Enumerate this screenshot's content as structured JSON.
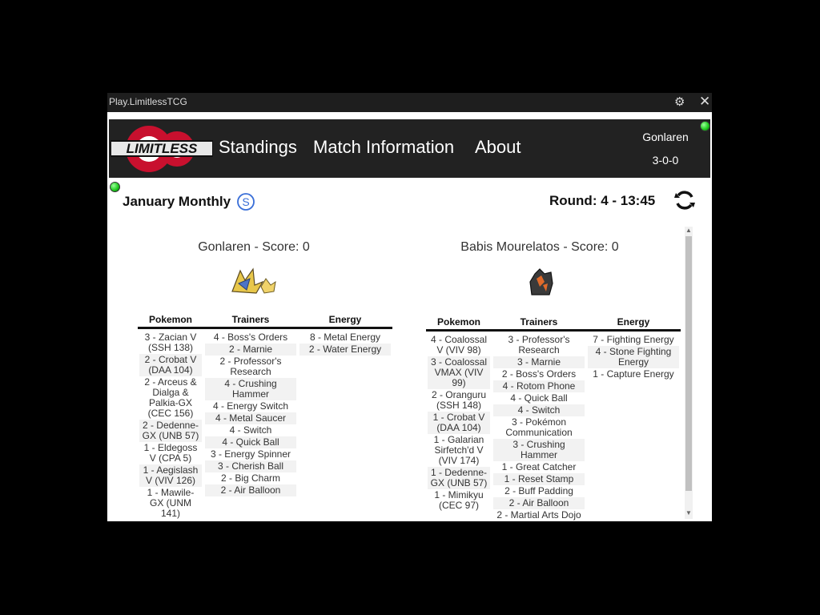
{
  "window": {
    "title": "Play.LimitlessTCG",
    "settings_icon": "gear-icon",
    "close_icon": "close-icon"
  },
  "nav": {
    "logo_text": "Limitless",
    "items": [
      "Standings",
      "Match Information",
      "About"
    ]
  },
  "user": {
    "name": "Gonlaren",
    "record": "3-0-0"
  },
  "tournament": {
    "name": "January Monthly",
    "round": "Round: 4 - 13:45"
  },
  "players": [
    {
      "label": "Gonlaren - Score: 0",
      "deck": {
        "headers": [
          "Pokemon",
          "Trainers",
          "Energy"
        ],
        "pokemon": [
          "3 - Zacian V (SSH 138)",
          "2 - Crobat V (DAA 104)",
          "2 - Arceus & Dialga & Palkia-GX (CEC 156)",
          "2 - Dedenne-GX (UNB 57)",
          "1 - Eldegoss V (CPA 5)",
          "1 - Aegislash V (VIV 126)",
          "1 - Mawile-GX (UNM 141)"
        ],
        "trainers": [
          "4 - Boss's Orders",
          "2 - Marnie",
          "2 - Professor's Research",
          "4 - Crushing Hammer",
          "4 - Energy Switch",
          "4 - Metal Saucer",
          "4 - Switch",
          "4 - Quick Ball",
          "3 - Energy Spinner",
          "3 - Cherish Ball",
          "2 - Big Charm",
          "2 - Air Balloon"
        ],
        "energy": [
          "8 - Metal Energy",
          "2 - Water Energy"
        ]
      }
    },
    {
      "label": "Babis Mourelatos - Score: 0",
      "deck": {
        "headers": [
          "Pokemon",
          "Trainers",
          "Energy"
        ],
        "pokemon": [
          "4 - Coalossal V (VIV 98)",
          "3 - Coalossal VMAX (VIV 99)",
          "2 - Oranguru (SSH 148)",
          "1 - Crobat V (DAA 104)",
          "1 - Galarian Sirfetch'd V (VIV 174)",
          "1 - Dedenne-GX (UNB 57)",
          "1 - Mimikyu (CEC 97)"
        ],
        "trainers": [
          "3 - Professor's Research",
          "3 - Marnie",
          "2 - Boss's Orders",
          "4 - Rotom Phone",
          "4 - Quick Ball",
          "4 - Switch",
          "3 - Pokémon Communication",
          "3 - Crushing Hammer",
          "1 - Great Catcher",
          "1 - Reset Stamp",
          "2 - Buff Padding",
          "2 - Air Balloon",
          "2 - Martial Arts Dojo"
        ],
        "energy": [
          "7 - Fighting Energy",
          "4 - Stone Fighting Energy",
          "1 - Capture Energy"
        ]
      }
    }
  ],
  "colors": {
    "header_bg": "#222222",
    "online": "#22cc22",
    "logo_red": "#c8102e"
  }
}
